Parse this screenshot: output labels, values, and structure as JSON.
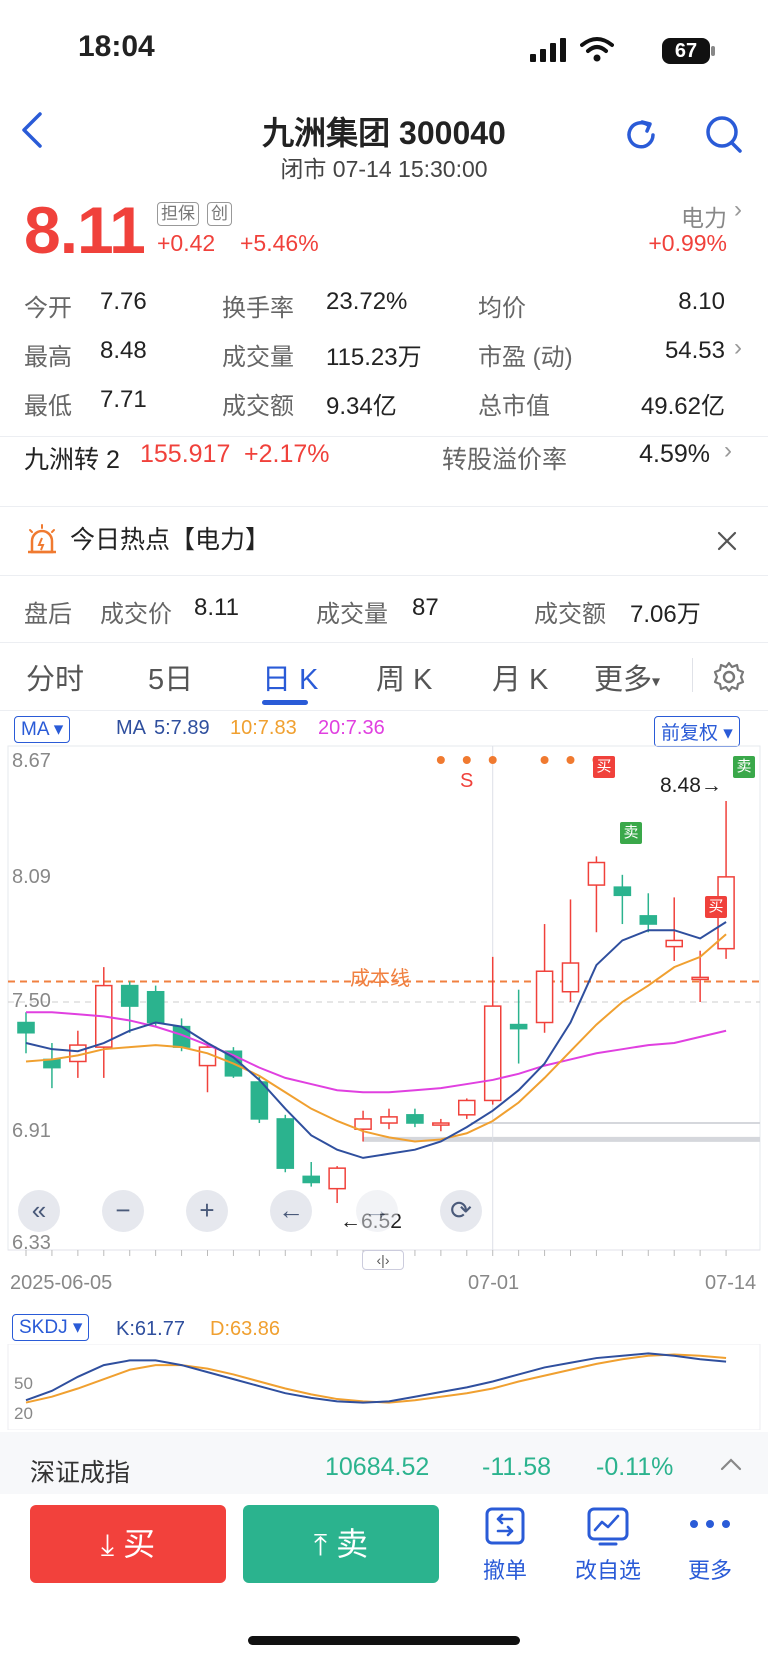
{
  "status_bar": {
    "time": "18:04",
    "battery": "67"
  },
  "header": {
    "title": "九洲集团 300040",
    "subtitle": "闭市 07-14 15:30:00"
  },
  "quote": {
    "price": "8.11",
    "tags": [
      "担保",
      "创"
    ],
    "change": "+0.42",
    "change_pct": "+5.46%",
    "sector": "电力",
    "sector_chg": "+0.99%",
    "rows": [
      [
        {
          "label": "今开",
          "value": "7.76",
          "color": "red"
        },
        {
          "label": "换手率",
          "value": "23.72%"
        },
        {
          "label": "均价",
          "value": "8.10",
          "color": "red"
        }
      ],
      [
        {
          "label": "最高",
          "value": "8.48",
          "color": "red"
        },
        {
          "label": "成交量",
          "value": "115.23万"
        },
        {
          "label": "市盈 (动)",
          "value": "54.53"
        }
      ],
      [
        {
          "label": "最低",
          "value": "7.71",
          "color": "red"
        },
        {
          "label": "成交额",
          "value": "9.34亿"
        },
        {
          "label": "总市值",
          "value": "49.62亿"
        }
      ]
    ]
  },
  "convertible": {
    "name": "九洲转 2",
    "price": "155.917",
    "change_pct": "+2.17%",
    "premium_label": "转股溢价率",
    "premium": "4.59%"
  },
  "hot": {
    "text": "今日热点【电力】"
  },
  "after_hours": {
    "label": "盘后",
    "price_label": "成交价",
    "price": "8.11",
    "vol_label": "成交量",
    "vol": "87",
    "amt_label": "成交额",
    "amt": "7.06万"
  },
  "tabs": [
    "分时",
    "5日",
    "日 K",
    "周 K",
    "月 K",
    "更多"
  ],
  "active_tab": 2,
  "indicator": {
    "ma_select": "MA",
    "ma_label": "MA",
    "ma5": "5:7.89",
    "ma10": "10:7.83",
    "ma20": "20:7.36",
    "adjust": "前复权",
    "colors": {
      "ma5": "#2f4f9e",
      "ma10": "#f0a030",
      "ma20": "#e040e0",
      "cost": "#f08040"
    }
  },
  "chart_data": {
    "type": "candlestick",
    "y_ticks": [
      "8.67",
      "8.09",
      "7.50",
      "6.91",
      "6.33"
    ],
    "x_ticks": [
      "2025-06-05",
      "07-01",
      "07-14"
    ],
    "cost_line_label": "成本线",
    "high_annotation": "8.48→",
    "low_annotation": "←6.52",
    "signal_s": "S",
    "buy_mark": "买",
    "sell_mark": "卖",
    "candles": [
      {
        "o": 7.4,
        "c": 7.35,
        "h": 7.45,
        "l": 7.25
      },
      {
        "o": 7.22,
        "c": 7.18,
        "h": 7.3,
        "l": 7.08
      },
      {
        "o": 7.21,
        "c": 7.29,
        "h": 7.36,
        "l": 7.13
      },
      {
        "o": 7.28,
        "c": 7.58,
        "h": 7.67,
        "l": 7.13
      },
      {
        "o": 7.58,
        "c": 7.48,
        "h": 7.6,
        "l": 7.35
      },
      {
        "o": 7.55,
        "c": 7.4,
        "h": 7.58,
        "l": 7.38
      },
      {
        "o": 7.38,
        "c": 7.28,
        "h": 7.42,
        "l": 7.26
      },
      {
        "o": 7.19,
        "c": 7.28,
        "h": 7.3,
        "l": 7.06
      },
      {
        "o": 7.26,
        "c": 7.14,
        "h": 7.28,
        "l": 7.13
      },
      {
        "o": 7.11,
        "c": 6.93,
        "h": 7.14,
        "l": 6.91
      },
      {
        "o": 6.93,
        "c": 6.69,
        "h": 6.95,
        "l": 6.67
      },
      {
        "o": 6.65,
        "c": 6.62,
        "h": 6.72,
        "l": 6.6
      },
      {
        "o": 6.59,
        "c": 6.69,
        "h": 6.7,
        "l": 6.52
      },
      {
        "o": 6.88,
        "c": 6.93,
        "h": 6.97,
        "l": 6.82
      },
      {
        "o": 6.91,
        "c": 6.94,
        "h": 6.98,
        "l": 6.88
      },
      {
        "o": 6.95,
        "c": 6.91,
        "h": 6.98,
        "l": 6.89
      },
      {
        "o": 6.9,
        "c": 6.91,
        "h": 6.93,
        "l": 6.87
      },
      {
        "o": 6.95,
        "c": 7.02,
        "h": 7.03,
        "l": 6.93
      },
      {
        "o": 7.02,
        "c": 7.48,
        "h": 7.72,
        "l": 7.0
      },
      {
        "o": 7.39,
        "c": 7.37,
        "h": 7.56,
        "l": 7.2
      },
      {
        "o": 7.4,
        "c": 7.65,
        "h": 7.88,
        "l": 7.35
      },
      {
        "o": 7.55,
        "c": 7.69,
        "h": 8.0,
        "l": 7.5
      },
      {
        "o": 8.07,
        "c": 8.18,
        "h": 8.21,
        "l": 7.84
      },
      {
        "o": 8.06,
        "c": 8.02,
        "h": 8.12,
        "l": 7.88
      },
      {
        "o": 7.92,
        "c": 7.88,
        "h": 8.03,
        "l": 7.84
      },
      {
        "o": 7.77,
        "c": 7.8,
        "h": 8.01,
        "l": 7.7
      },
      {
        "o": 7.62,
        "c": 7.62,
        "h": 7.75,
        "l": 7.5
      },
      {
        "o": 7.76,
        "c": 8.11,
        "h": 8.48,
        "l": 7.71
      }
    ],
    "ma5": [
      7.3,
      7.27,
      7.26,
      7.3,
      7.36,
      7.4,
      7.38,
      7.3,
      7.23,
      7.12,
      6.98,
      6.85,
      6.78,
      6.74,
      6.76,
      6.78,
      6.82,
      6.89,
      6.97,
      7.07,
      7.2,
      7.4,
      7.68,
      7.8,
      7.85,
      7.85,
      7.81,
      7.89
    ],
    "ma10": [
      7.21,
      7.22,
      7.24,
      7.27,
      7.28,
      7.29,
      7.28,
      7.25,
      7.2,
      7.14,
      7.06,
      6.98,
      6.92,
      6.87,
      6.84,
      6.82,
      6.83,
      6.86,
      6.92,
      7.01,
      7.13,
      7.26,
      7.39,
      7.5,
      7.58,
      7.67,
      7.72,
      7.83
    ],
    "ma20": [
      7.45,
      7.45,
      7.44,
      7.43,
      7.41,
      7.38,
      7.34,
      7.29,
      7.24,
      7.18,
      7.13,
      7.1,
      7.07,
      7.06,
      7.06,
      7.07,
      7.08,
      7.1,
      7.12,
      7.15,
      7.19,
      7.22,
      7.25,
      7.27,
      7.29,
      7.3,
      7.33,
      7.36
    ],
    "skdj": {
      "select": "SKDJ",
      "k_label": "K:61.77",
      "d_label": "D:63.86",
      "y_ticks": [
        "50",
        "20"
      ],
      "k": [
        22,
        30,
        42,
        52,
        56,
        56,
        52,
        46,
        40,
        34,
        28,
        24,
        21,
        20,
        21,
        25,
        29,
        33,
        38,
        44,
        50,
        54,
        58,
        60,
        62,
        60,
        57,
        55
      ],
      "d": [
        20,
        25,
        32,
        40,
        48,
        52,
        52,
        49,
        44,
        38,
        32,
        27,
        23,
        21,
        20,
        22,
        25,
        28,
        32,
        38,
        43,
        48,
        53,
        57,
        60,
        61,
        60,
        58
      ]
    }
  },
  "chart_controls": [
    "«",
    "−",
    "+",
    "←",
    "→",
    "⟳"
  ],
  "index_bar": {
    "name": "深证成指",
    "value": "10684.52",
    "change": "-11.58",
    "change_pct": "-0.11%"
  },
  "actions": {
    "buy": "买",
    "sell": "卖",
    "cancel": "撤单",
    "edit_watch": "改自选",
    "more": "更多"
  }
}
